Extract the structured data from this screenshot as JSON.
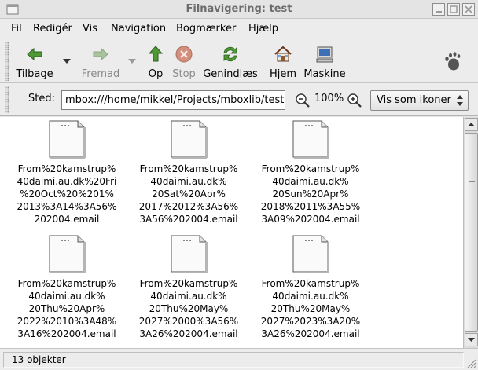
{
  "window": {
    "title": "Filnavigering: test"
  },
  "menu": [
    "Fil",
    "Redigér",
    "Vis",
    "Navigation",
    "Bogmærker",
    "Hjælp"
  ],
  "toolbar": {
    "back": "Tilbage",
    "forward": "Fremad",
    "up": "Op",
    "stop": "Stop",
    "reload": "Genindlæs",
    "home": "Hjem",
    "computer": "Maskine"
  },
  "location": {
    "label": "Sted:",
    "value": "mbox:///home/mikkel/Projects/mboxlib/test"
  },
  "zoom": {
    "level": "100%"
  },
  "view": {
    "selected": "Vis som ikoner"
  },
  "files": [
    {
      "lines": [
        "From%20kamstrup%",
        "40daimi.au.dk%20Fri",
        "%20Oct%20%201%",
        "2013%3A14%3A56%",
        "202004.email"
      ]
    },
    {
      "lines": [
        "From%20kamstrup%",
        "40daimi.au.dk%",
        "20Sat%20Apr%",
        "2017%2012%3A56%",
        "3A56%202004.email"
      ]
    },
    {
      "lines": [
        "From%20kamstrup%",
        "40daimi.au.dk%",
        "20Sun%20Apr%",
        "2018%2011%3A55%",
        "3A09%202004.email"
      ]
    },
    {
      "lines": [
        "From%20kamstrup%",
        "40daimi.au.dk%",
        "20Thu%20Apr%",
        "2022%2010%3A48%",
        "3A16%202004.email"
      ]
    },
    {
      "lines": [
        "From%20kamstrup%",
        "40daimi.au.dk%",
        "20Thu%20May%",
        "2027%2000%3A56%",
        "3A26%202004.email"
      ]
    },
    {
      "lines": [
        "From%20kamstrup%",
        "40daimi.au.dk%",
        "20Thu%20May%",
        "2027%2023%3A20%",
        "3A26%202004.email"
      ]
    }
  ],
  "status": {
    "text": "13 objekter"
  },
  "colors": {
    "back_arrow": "#3b7a2a",
    "up_arrow": "#3b7a2a",
    "stop_red": "#c4513a",
    "disabled": "#9aa89a"
  }
}
